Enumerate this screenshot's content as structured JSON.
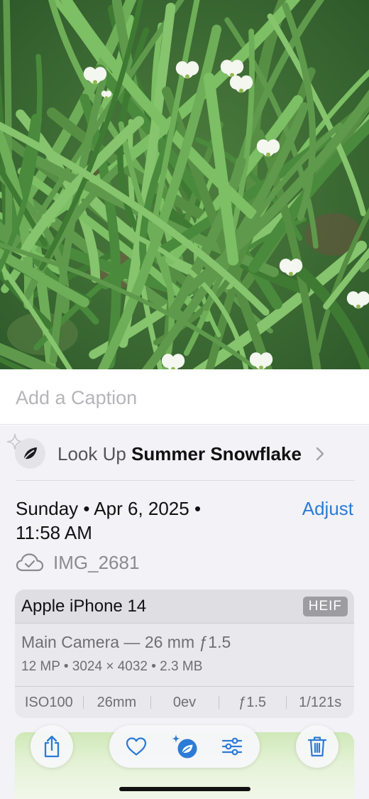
{
  "photo": {
    "alt_icon": "photo-summer-snowflake"
  },
  "caption": {
    "placeholder": "Add a Caption"
  },
  "lookup": {
    "prefix": "Look Up",
    "subject": "Summer Snowflake",
    "icon": "leaf-icon",
    "chevron_icon": "chevron-right-icon"
  },
  "metadata": {
    "date_text": "Sunday • Apr 6, 2025 • 11:58 AM",
    "adjust_label": "Adjust",
    "filename": "IMG_2681",
    "cloud_icon": "icloud-check-icon"
  },
  "exif": {
    "device": "Apple iPhone 14",
    "format": "HEIF",
    "lens": "Main Camera — 26 mm ƒ1.5",
    "specs": "12 MP • 3024 × 4032 • 2.3 MB",
    "stats": [
      "ISO100",
      "26mm",
      "0ev",
      "ƒ1.5",
      "1/121s"
    ]
  },
  "toolbar": {
    "share_icon": "share-icon",
    "favorite_icon": "heart-icon",
    "visual_lookup_icon": "visual-lookup-icon",
    "edit_icon": "sliders-icon",
    "delete_icon": "trash-icon",
    "accent_color": "#2c7bd6"
  }
}
